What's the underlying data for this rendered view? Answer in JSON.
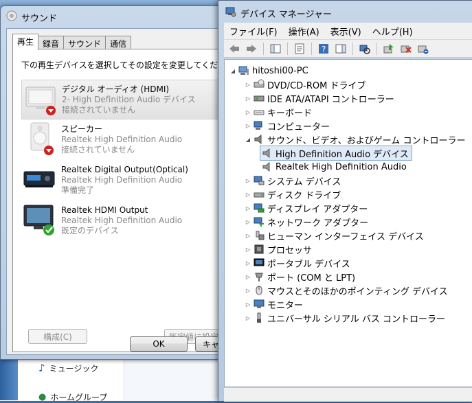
{
  "sound": {
    "title": "サウンド",
    "tabs": [
      "再生",
      "録音",
      "サウンド",
      "通信"
    ],
    "instruction": "下の再生デバイスを選択してその設定を変更してください:",
    "devices": [
      {
        "name": "デジタル オーディオ (HDMI)",
        "driver": "2- High Definition Audio デバイス",
        "status": "接続されていません"
      },
      {
        "name": "スピーカー",
        "driver": "Realtek High Definition Audio",
        "status": "接続されていません"
      },
      {
        "name": "Realtek Digital Output(Optical)",
        "driver": "Realtek High Definition Audio",
        "status": "準備完了"
      },
      {
        "name": "Realtek HDMI Output",
        "driver": "Realtek High Definition Audio",
        "status": "既定のデバイス"
      }
    ],
    "configure_label": "構成(C)",
    "set_default_label": "既定値に設定(S",
    "ok_label": "OK",
    "cancel_label": "キャ"
  },
  "explorer": {
    "music_label": "ミュージック",
    "homegroup_label": "ホームグループ"
  },
  "devmgr": {
    "title": "デバイス マネージャー",
    "menu": [
      "ファイル(F)",
      "操作(A)",
      "表示(V)",
      "ヘルプ(H)"
    ],
    "root": "hitoshi00-PC",
    "categories": [
      {
        "label": "DVD/CD-ROM ドライブ",
        "icon": "optical-drive-icon"
      },
      {
        "label": "IDE ATA/ATAPI コントローラー",
        "icon": "ide-controller-icon"
      },
      {
        "label": "キーボード",
        "icon": "keyboard-icon"
      },
      {
        "label": "コンピューター",
        "icon": "computer-icon"
      },
      {
        "label": "サウンド、ビデオ、およびゲーム コントローラー",
        "icon": "speaker-icon"
      },
      {
        "label": "システム デバイス",
        "icon": "system-device-icon"
      },
      {
        "label": "ディスク ドライブ",
        "icon": "disk-drive-icon"
      },
      {
        "label": "ディスプレイ アダプター",
        "icon": "display-adapter-icon"
      },
      {
        "label": "ネットワーク アダプター",
        "icon": "network-adapter-icon"
      },
      {
        "label": "ヒューマン インターフェイス デバイス",
        "icon": "hid-icon"
      },
      {
        "label": "プロセッサ",
        "icon": "processor-icon"
      },
      {
        "label": "ポータブル デバイス",
        "icon": "portable-device-icon"
      },
      {
        "label": "ポート (COM と LPT)",
        "icon": "port-icon"
      },
      {
        "label": "マウスとそのほかのポインティング デバイス",
        "icon": "mouse-icon"
      },
      {
        "label": "モニター",
        "icon": "monitor-icon"
      },
      {
        "label": "ユニバーサル シリアル バス コントローラー",
        "icon": "usb-icon"
      }
    ],
    "sound_children": [
      "High Definition Audio デバイス",
      "Realtek High Definition Audio"
    ]
  },
  "colors": {
    "selection_border": "#7da2ce",
    "selection_fill": "#dfeaf7",
    "default_check": "#2fa52f"
  }
}
